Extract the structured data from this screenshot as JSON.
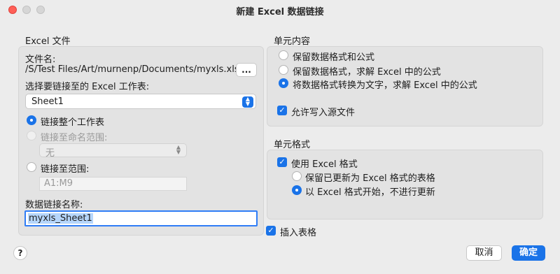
{
  "window": {
    "title": "新建 Excel 数据链接"
  },
  "excel_file": {
    "group_label": "Excel 文件",
    "file_name_label": "文件名:",
    "file_path": "/S/Test Files/Art/murnenp/Documents/myxls.xlsx",
    "browse_label": "...",
    "select_sheet_label": "选择要链接至的 Excel 工作表:",
    "sheet_selected": "Sheet1",
    "link_whole_sheet_label": "链接整个工作表",
    "link_named_range_label": "链接至命名范围:",
    "named_range_value": "无",
    "link_range_label": "链接至范围:",
    "range_value": "A1:M9",
    "link_name_label": "数据链接名称:",
    "link_name_value": "myxls_Sheet1"
  },
  "cell_content": {
    "group_label": "单元内容",
    "option1": "保留数据格式和公式",
    "option2": "保留数据格式，求解 Excel 中的公式",
    "option3": "将数据格式转换为文字，求解 Excel 中的公式",
    "allow_write_label": "允许写入源文件"
  },
  "cell_format": {
    "group_label": "单元格式",
    "use_excel_format_label": "使用 Excel 格式",
    "keep_updated_label": "保留已更新为 Excel 格式的表格",
    "start_no_update_label": "以 Excel 格式开始，不进行更新"
  },
  "insert_table_label": "插入表格",
  "footer": {
    "help_label": "?",
    "cancel_label": "取消",
    "ok_label": "确定"
  },
  "colors": {
    "accent": "#1a73e8",
    "window_bg": "#ececec",
    "group_bg": "#e3e3e3"
  }
}
